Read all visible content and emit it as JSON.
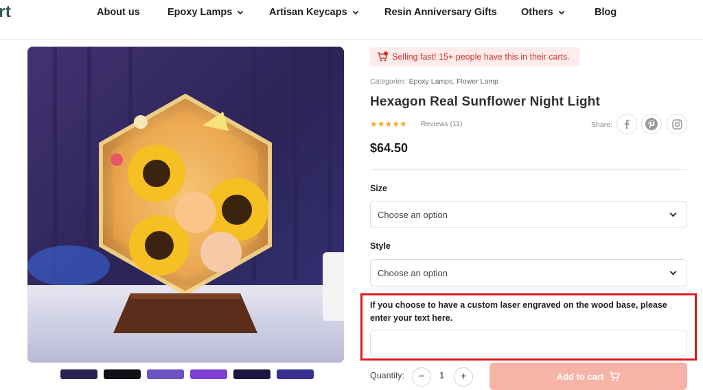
{
  "header": {
    "logo": "rt",
    "nav": [
      {
        "label": "About us"
      },
      {
        "label": "Epoxy Lamps"
      },
      {
        "label": "Artisan Keycaps"
      },
      {
        "label": "Resin Anniversary Gifts"
      },
      {
        "label": "Others"
      },
      {
        "label": "Blog"
      }
    ]
  },
  "product": {
    "badge": "Selling fast!  15+ people have this in their carts.",
    "categories_label": "Categories:",
    "category_1": "Epoxy Lamps",
    "category_sep": ",",
    "category_2": "Flower Lamp",
    "title": "Hexagon Real Sunflower Night Light",
    "stars": "★★★★★",
    "rating": 5,
    "reviews": "Reviews (11)",
    "share_label": "Share:",
    "share_icons": [
      "facebook-icon",
      "pinterest-icon",
      "instagram-icon"
    ],
    "price": "$64.50"
  },
  "options": {
    "size_label": "Size",
    "size_value": "Choose an option",
    "style_label": "Style",
    "style_value": "Choose an option"
  },
  "engraving": {
    "label": "If you choose to have a custom laser engraved on the wood base, please enter your text here.",
    "value": ""
  },
  "purchase": {
    "quantity_label": "Quantity:",
    "minus": "−",
    "quantity": "1",
    "plus": "+",
    "add_to_cart": "Add to cart"
  },
  "colors": {
    "accent": "#f6b3a6",
    "badge_bg": "#fdecea",
    "badge_text": "#d0342c",
    "highlight_border": "#e0151b",
    "star": "#f5a623"
  }
}
